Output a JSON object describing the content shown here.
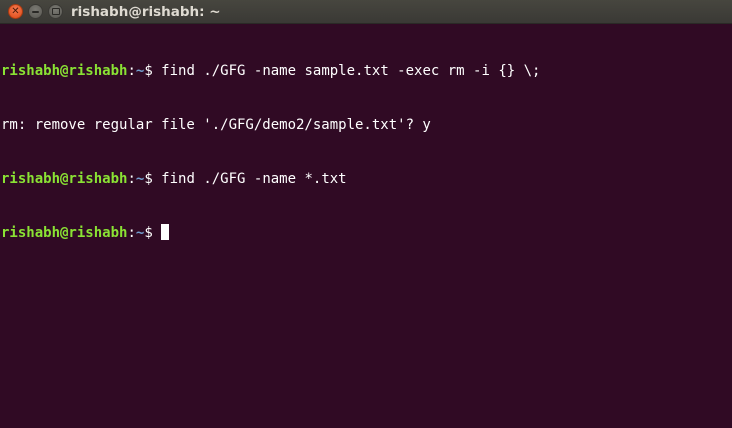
{
  "window": {
    "title": "rishabh@rishabh: ~",
    "controls": {
      "close_icon": "close-icon",
      "minimize_icon": "minimize-icon",
      "maximize_icon": "maximize-icon"
    }
  },
  "colors": {
    "background": "#300a24",
    "prompt_user": "#8ae234",
    "prompt_path": "#729fcf",
    "text": "#ffffff",
    "close_button": "#dd4814"
  },
  "terminal": {
    "lines": [
      {
        "type": "command",
        "user_host": "rishabh@rishabh",
        "colon": ":",
        "path": "~",
        "dollar": "$ ",
        "command": "find ./GFG -name sample.txt -exec rm -i {} \\;"
      },
      {
        "type": "output",
        "text": "rm: remove regular file './GFG/demo2/sample.txt'? y"
      },
      {
        "type": "command",
        "user_host": "rishabh@rishabh",
        "colon": ":",
        "path": "~",
        "dollar": "$ ",
        "command": "find ./GFG -name *.txt"
      },
      {
        "type": "prompt",
        "user_host": "rishabh@rishabh",
        "colon": ":",
        "path": "~",
        "dollar": "$ ",
        "command": ""
      }
    ]
  }
}
